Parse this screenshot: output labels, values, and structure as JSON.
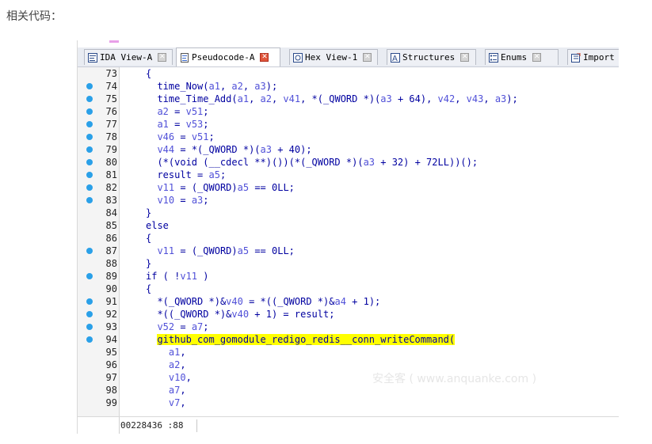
{
  "caption": "相关代码：",
  "tabs": [
    {
      "label": "IDA View-A",
      "icon": "ida-view-icon",
      "active": false
    },
    {
      "label": "Pseudocode-A",
      "icon": "pseudocode-icon",
      "active": true
    },
    {
      "label": "Hex View-1",
      "icon": "hex-view-icon",
      "active": false
    },
    {
      "label": "Structures",
      "icon": "structures-icon",
      "active": false
    },
    {
      "label": "Enums",
      "icon": "enums-icon",
      "active": false
    },
    {
      "label": "Import",
      "icon": "imports-icon",
      "active": false
    }
  ],
  "code_lines": [
    {
      "num": "73",
      "dot": false,
      "text": "{"
    },
    {
      "num": "74",
      "dot": true,
      "text": "  time_Now(a1, a2, a3);"
    },
    {
      "num": "75",
      "dot": true,
      "text": "  time_Time_Add(a1, a2, v41, *(_QWORD *)(a3 + 64), v42, v43, a3);"
    },
    {
      "num": "76",
      "dot": true,
      "text": "  a2 = v51;"
    },
    {
      "num": "77",
      "dot": true,
      "text": "  a1 = v53;"
    },
    {
      "num": "78",
      "dot": true,
      "text": "  v46 = v51;"
    },
    {
      "num": "79",
      "dot": true,
      "text": "  v44 = *(_QWORD *)(a3 + 40);"
    },
    {
      "num": "80",
      "dot": true,
      "text": "  (*(void (__cdecl **)())(*(_QWORD *)(a3 + 32) + 72LL))();"
    },
    {
      "num": "81",
      "dot": true,
      "text": "  result = a5;"
    },
    {
      "num": "82",
      "dot": true,
      "text": "  v11 = (_QWORD)a5 == 0LL;"
    },
    {
      "num": "83",
      "dot": true,
      "text": "  v10 = a3;"
    },
    {
      "num": "84",
      "dot": false,
      "text": "}"
    },
    {
      "num": "85",
      "dot": false,
      "text": "else"
    },
    {
      "num": "86",
      "dot": false,
      "text": "{"
    },
    {
      "num": "87",
      "dot": true,
      "text": "  v11 = (_QWORD)a5 == 0LL;"
    },
    {
      "num": "88",
      "dot": false,
      "text": "}"
    },
    {
      "num": "89",
      "dot": true,
      "text": "if ( !v11 )"
    },
    {
      "num": "90",
      "dot": false,
      "text": "{"
    },
    {
      "num": "91",
      "dot": true,
      "text": "  *(_QWORD *)&v40 = *((_QWORD *)&a4 + 1);"
    },
    {
      "num": "92",
      "dot": true,
      "text": "  *((_QWORD *)&v40 + 1) = result;"
    },
    {
      "num": "93",
      "dot": true,
      "text": "  v52 = a7;"
    },
    {
      "num": "94",
      "dot": true,
      "text": "  github_com_gomodule_redigo_redis__conn_writeCommand(",
      "highlight": "github_com_gomodule_redigo_redis__conn_writeCommand("
    },
    {
      "num": "95",
      "dot": false,
      "text": "    a1,"
    },
    {
      "num": "96",
      "dot": false,
      "text": "    a2,"
    },
    {
      "num": "97",
      "dot": false,
      "text": "    v10,"
    },
    {
      "num": "98",
      "dot": false,
      "text": "    a7,"
    },
    {
      "num": "99",
      "dot": false,
      "text": "    v7,"
    }
  ],
  "status": "00228436 :88",
  "watermark": "安全客 ( www.anquanke.com )",
  "colors": {
    "highlight": "#ffff00",
    "breakpoint_dot": "#2aa0e8",
    "keyword": "#0000a0",
    "variable": "#5050d8"
  }
}
